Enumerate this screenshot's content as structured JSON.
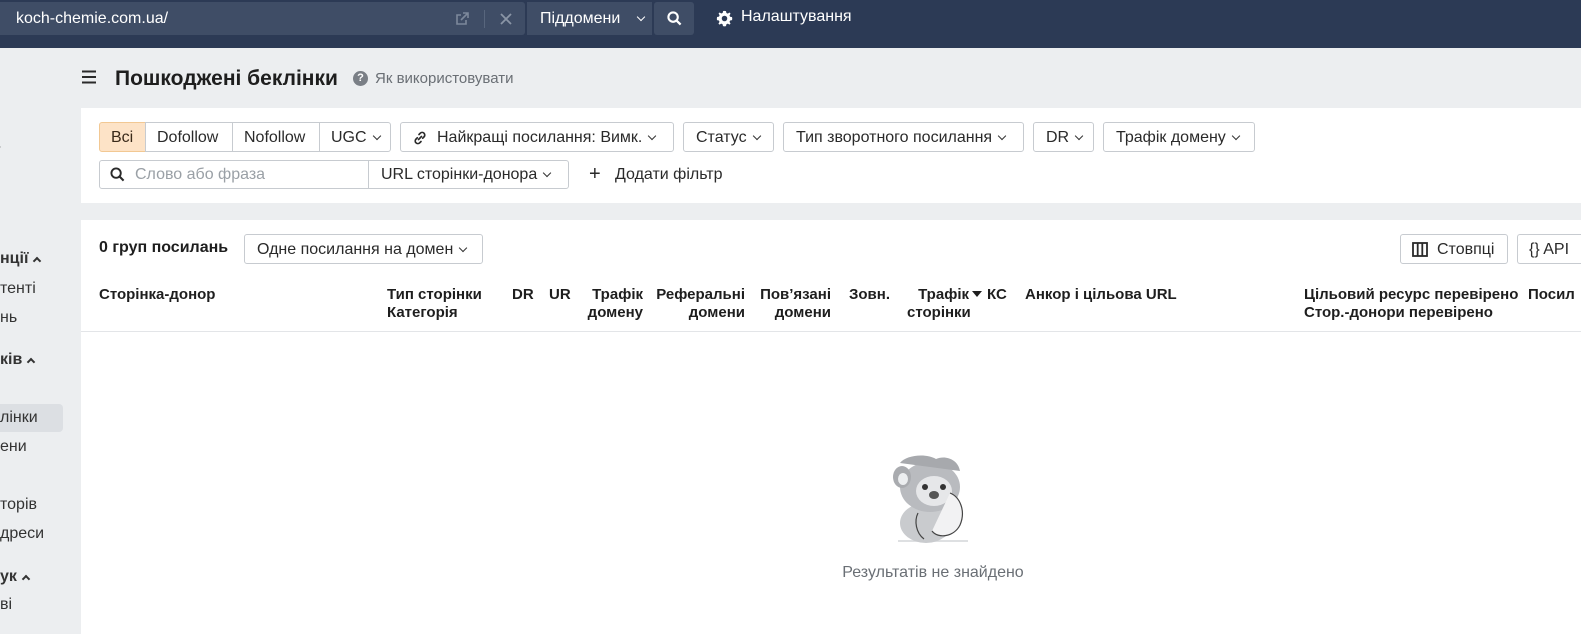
{
  "topbar": {
    "url": "koch-chemie.com.ua/",
    "subdomains_label": "Піддомени",
    "settings_label": "Налаштування"
  },
  "sidebar": {
    "items": [
      {
        "label": "/",
        "bold": false
      },
      {
        "label": "нції",
        "bold": true
      },
      {
        "label": "тенті",
        "bold": false
      },
      {
        "label": "нь",
        "bold": false
      },
      {
        "label": "ків",
        "bold": true
      },
      {
        "label": "лінки",
        "bold": false,
        "active": true
      },
      {
        "label": "ени",
        "bold": false
      },
      {
        "label": "торів",
        "bold": false
      },
      {
        "label": "дреси",
        "bold": false
      },
      {
        "label": "ук",
        "bold": true
      },
      {
        "label": "ві",
        "bold": false
      }
    ]
  },
  "header": {
    "title": "Пошкоджені беклінки",
    "help_label": "Як використовувати"
  },
  "filters": {
    "link_types": [
      "Всі",
      "Dofollow",
      "Nofollow",
      "UGC"
    ],
    "active_link_type": "Всі",
    "best_links": "Найкращі посилання: Вимк.",
    "status": "Статус",
    "backlink_type": "Тип зворотного посилання",
    "dr": "DR",
    "domain_traffic": "Трафік домену",
    "search_placeholder": "Слово або фраза",
    "search_value": "",
    "url_donor": "URL сторінки-донора",
    "add_filter": "Додати фільтр"
  },
  "results": {
    "groups_count": "0 груп посилань",
    "grouping": "Одне посилання на домен",
    "columns_label": "Стовпці",
    "api_label": "{} API",
    "headers": {
      "donor_page": "Сторінка-донор",
      "page_type": "Тип сторінки",
      "category": "Категорія",
      "dr": "DR",
      "ur": "UR",
      "domain_traffic_1": "Трафік",
      "domain_traffic_2": "домену",
      "ref_domains_1": "Реферальні",
      "ref_domains_2": "домени",
      "linked_domains_1": "Пов’язані",
      "linked_domains_2": "домени",
      "external": "Зовн.",
      "page_traffic_1": "Трафік",
      "page_traffic_2": "сторінки",
      "kc": "КС",
      "anchor_url": "Анкор і цільова URL",
      "target_checked": "Цільовий ресурс перевірено",
      "donor_checked": "Стор.-донори перевірено",
      "links": "Посил"
    },
    "empty_message": "Результатів не знайдено"
  }
}
